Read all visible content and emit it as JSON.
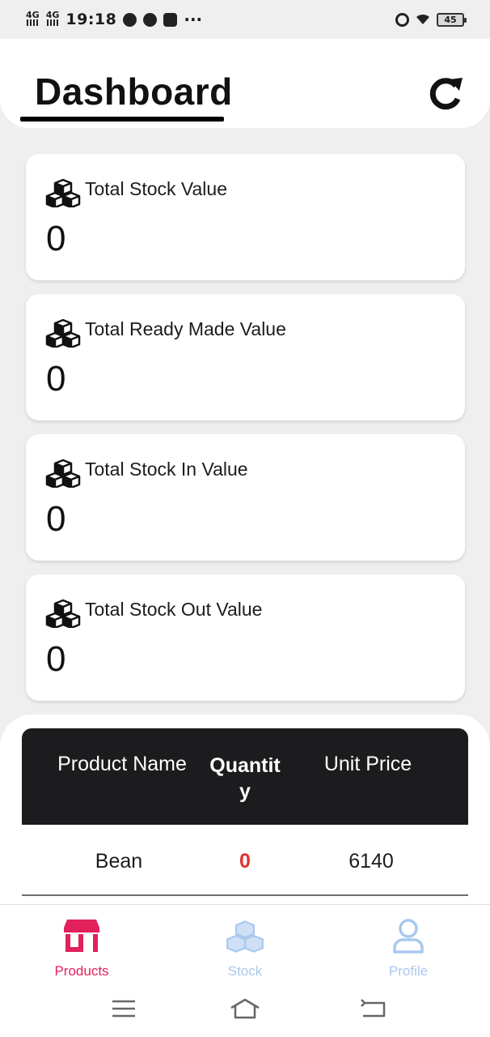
{
  "status_bar": {
    "net1": "4G",
    "net2": "4G",
    "time": "19:18",
    "dots": "···",
    "battery": "45"
  },
  "header": {
    "title": "Dashboard"
  },
  "cards": [
    {
      "label": "Total Stock Value",
      "value": "0"
    },
    {
      "label": "Total Ready Made Value",
      "value": "0"
    },
    {
      "label": "Total Stock In Value",
      "value": "0"
    },
    {
      "label": "Total Stock Out Value",
      "value": "0"
    }
  ],
  "table": {
    "headers": {
      "name": "Product Name",
      "quantity": "Quantity",
      "price": "Unit Price"
    },
    "rows": [
      {
        "name": "Bean",
        "quantity": "0",
        "price": "6140"
      }
    ]
  },
  "nav": {
    "items": [
      {
        "label": "Products",
        "icon": "store-icon",
        "active": true
      },
      {
        "label": "Stock",
        "icon": "boxes-icon",
        "active": false
      },
      {
        "label": "Profile",
        "icon": "user-icon",
        "active": false
      }
    ]
  },
  "colors": {
    "accent": "#e2205c",
    "inactive": "#a9c8ee",
    "table_header": "#1c1c1e",
    "quantity_zero": "#e0312f"
  }
}
